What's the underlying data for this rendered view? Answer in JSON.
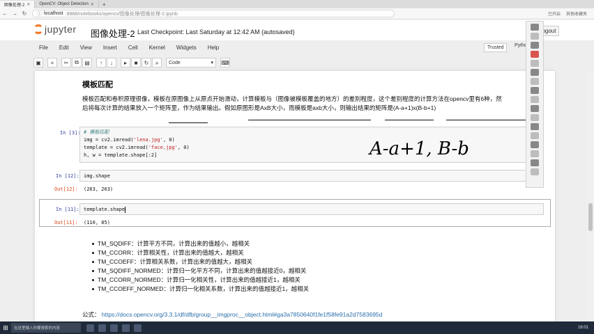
{
  "browser": {
    "tabs": [
      {
        "title": "图像处理-2",
        "active": true
      },
      {
        "title": "OpenCV: Object Detection",
        "active": false
      }
    ],
    "url_host": "localhost",
    "url_rest": ":8888/notebooks/opencv/图像处理/图像处理-2.ipynb",
    "right_labels": [
      "已开启",
      "其他收藏夹"
    ]
  },
  "header": {
    "logo_text": "jupyter",
    "notebook_title": "图像处理-2",
    "checkpoint": "Last Checkpoint: Last Saturday at 12:42 AM (autosaved)",
    "logout_label": "Logout"
  },
  "menu": {
    "items": [
      "File",
      "Edit",
      "View",
      "Insert",
      "Cell",
      "Kernel",
      "Widgets",
      "Help"
    ],
    "trusted_label": "Trusted",
    "kernel_label": "Python 3"
  },
  "toolbar": {
    "cell_type": "Code"
  },
  "notebook": {
    "heading": "模板匹配",
    "para_line1": "模板匹配和卷积原理很像，模板在原图像上从原点开始滑动，计算模板与（图像被模板覆盖的地方）的差别程度，这个差别程度的计算方法在opencv里有6种，然",
    "para_line2_a": "后将每次计算的结果放入一个矩阵里，作为结果输出。",
    "para_line2_b": "假如原图形是AxB大小",
    "para_line2_c": "，而模板是axb大小",
    "para_line2_d": "，则输出结果的矩阵是(A-a+1)x(B-b+1)",
    "cells": [
      {
        "in_prompt": "In [3]:",
        "lines": {
          "comment": "# 模板匹配",
          "l2_pre": "img = cv2.imread(",
          "l2_str": "'lena.jpg'",
          "l2_post": ", 0)",
          "l3_pre": "template = cv2.imread(",
          "l3_str": "'face.jpg'",
          "l3_post": ", 0)",
          "l4": "h, w = template.shape[:2]"
        }
      },
      {
        "in_prompt": "In [12]:",
        "code": "img.shape",
        "out_prompt": "Out[12]:",
        "output": "(263, 263)"
      },
      {
        "in_prompt": "In [11]:",
        "code": "template.shape",
        "out_prompt": "Out[11]:",
        "output": "(110, 85)"
      }
    ],
    "handwriting": "A-a+1, B-b",
    "bullets": [
      "TM_SQDIFF：计算平方不同，计算出来的值越小，越相关",
      "TM_CCORR：计算相关性，计算出来的值越大，越相关",
      "TM_CCOEFF：计算相关系数，计算出来的值越大，越相关",
      "TM_SQDIFF_NORMED：计算归一化平方不同，计算出来的值越接近0，越相关",
      "TM_CCORR_NORMED：计算归一化相关性，计算出来的值越接近1，越相关",
      "TM_CCOEFF_NORMED：计算归一化相关系数，计算出来的值越接近1，越相关"
    ],
    "formula_label": "公式：",
    "formula_link": "https://docs.opencv.org/3.3.1/df/dfb/group__imgproc__object.html#ga3a7850640f1fe1f58fe91a2d7583695d"
  },
  "taskbar": {
    "search_placeholder": "在这里输入你要搜索的内容",
    "clock": "16:01"
  },
  "colors": {
    "prompt_in": "#303f9f",
    "prompt_out": "#d84315",
    "logo_orange": "#f37726",
    "link": "#296eaa"
  }
}
